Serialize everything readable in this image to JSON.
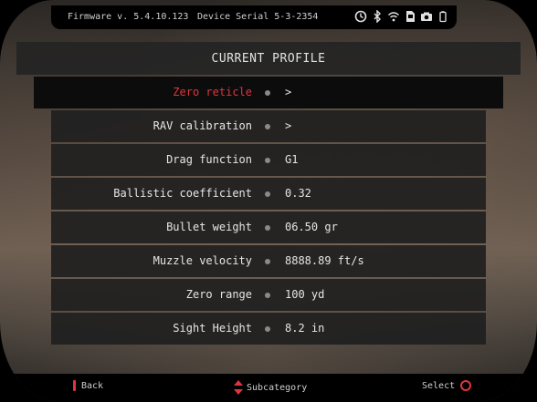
{
  "status_bar": {
    "firmware_label": "Firmware v. 5.4.10.123",
    "serial_label": "Device Serial 5-3-2354",
    "icons": [
      "timer-icon",
      "bluetooth-icon",
      "wifi-icon",
      "sd-card-icon",
      "camera-icon",
      "battery-icon"
    ]
  },
  "header": {
    "title": "CURRENT PROFILE"
  },
  "menu": {
    "items": [
      {
        "label": "Zero reticle",
        "value": ">"
      },
      {
        "label": "RAV calibration",
        "value": ">"
      },
      {
        "label": "Drag function",
        "value": "G1"
      },
      {
        "label": "Ballistic coefficient",
        "value": "0.32"
      },
      {
        "label": "Bullet weight",
        "value": "06.50 gr"
      },
      {
        "label": "Muzzle velocity",
        "value": "8888.89 ft/s"
      },
      {
        "label": "Zero range",
        "value": "100 yd"
      },
      {
        "label": "Sight Height",
        "value": "8.2 in"
      }
    ]
  },
  "footer": {
    "back_label": "Back",
    "sub_label": "Subcategory",
    "select_label": "Select"
  },
  "colors": {
    "accent": "#e0343e",
    "row_bg": "#202020",
    "active_bg": "#0c0c0c"
  }
}
